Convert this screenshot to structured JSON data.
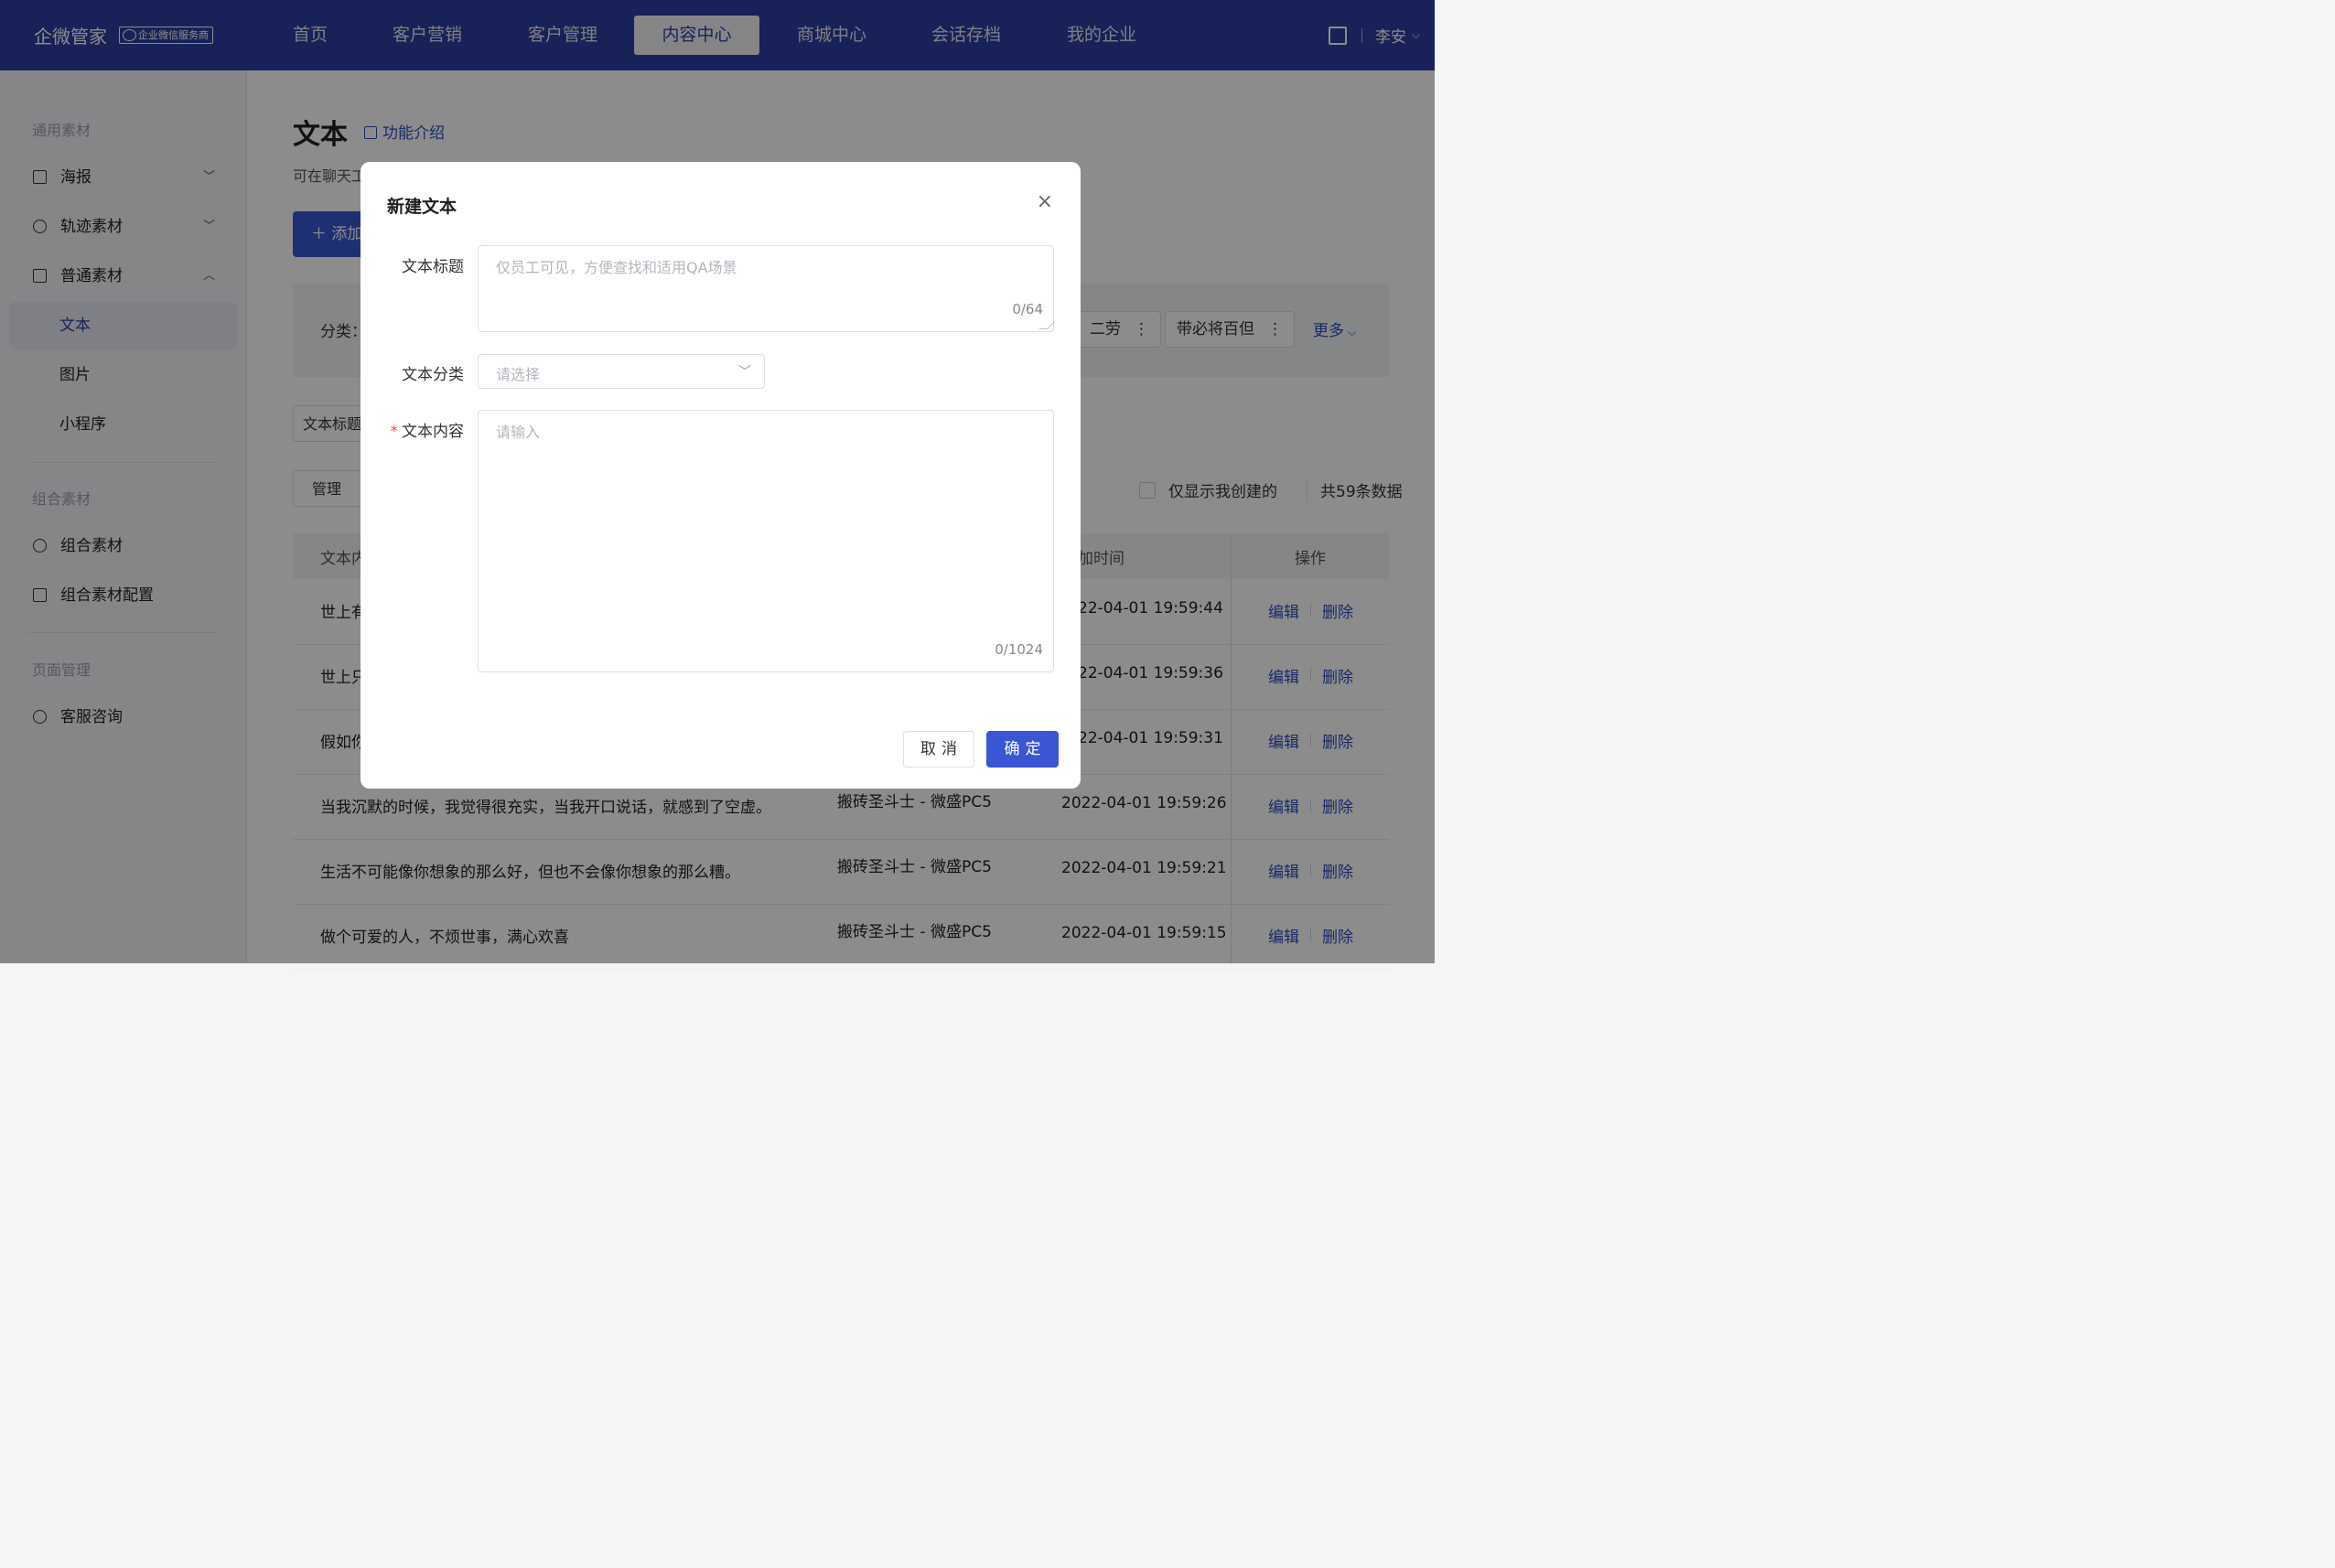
{
  "brand": {
    "name": "企微管家",
    "badge": "企业微信服务商"
  },
  "nav": {
    "items": [
      "首页",
      "客户营销",
      "客户管理",
      "内容中心",
      "商城中心",
      "会话存档",
      "我的企业"
    ],
    "active": "内容中心",
    "user": "李安"
  },
  "sidebar": {
    "group1": "通用素材",
    "poster": "海报",
    "track": "轨迹素材",
    "normal": "普通素材",
    "sub_text": "文本",
    "sub_image": "图片",
    "sub_mini": "小程序",
    "group2": "组合素材",
    "combo": "组合素材",
    "combo_config": "组合素材配置",
    "group3": "页面管理",
    "service": "客服咨询"
  },
  "page": {
    "title": "文本",
    "feature_link": "功能介绍",
    "desc": "可在聊天工",
    "add_button": "添加",
    "category_label": "分类：",
    "categories": [
      "二劳",
      "带必将百但"
    ],
    "more": "更多",
    "search_label": "文本标题",
    "manage": "管理",
    "only_mine": "仅显示我创建的",
    "total": "共59条数据"
  },
  "table": {
    "headers": {
      "content": "文本内",
      "time": "加时间",
      "ops": "操作"
    },
    "edit": "编辑",
    "delete": "删除",
    "rows": [
      {
        "content": "世上有",
        "creator": "",
        "time": "22-04-01 19:59:44"
      },
      {
        "content": "世上只",
        "creator": "",
        "time": "22-04-01 19:59:36"
      },
      {
        "content": "假如你",
        "creator": "",
        "time": "22-04-01 19:59:31"
      },
      {
        "content": "当我沉默的时候，我觉得很充实，当我开口说话，就感到了空虚。",
        "creator": "搬砖圣斗士 - 微盛PC5",
        "time": "2022-04-01 19:59:26"
      },
      {
        "content": "生活不可能像你想象的那么好，但也不会像你想象的那么糟。",
        "creator": "搬砖圣斗士 - 微盛PC5",
        "time": "2022-04-01 19:59:21"
      },
      {
        "content": "做个可爱的人，不烦世事，满心欢喜",
        "creator": "搬砖圣斗士 - 微盛PC5",
        "time": "2022-04-01 19:59:15"
      }
    ]
  },
  "modal": {
    "title": "新建文本",
    "close_glyph": "×",
    "title_label": "文本标题",
    "title_placeholder": "仅员工可见，方便查找和适用QA场景",
    "title_count": "0/64",
    "category_label": "文本分类",
    "category_placeholder": "请选择",
    "content_required": "*",
    "content_label": "文本内容",
    "content_placeholder": "请输入",
    "content_count": "0/1024",
    "cancel": "取消",
    "confirm": "确定"
  }
}
